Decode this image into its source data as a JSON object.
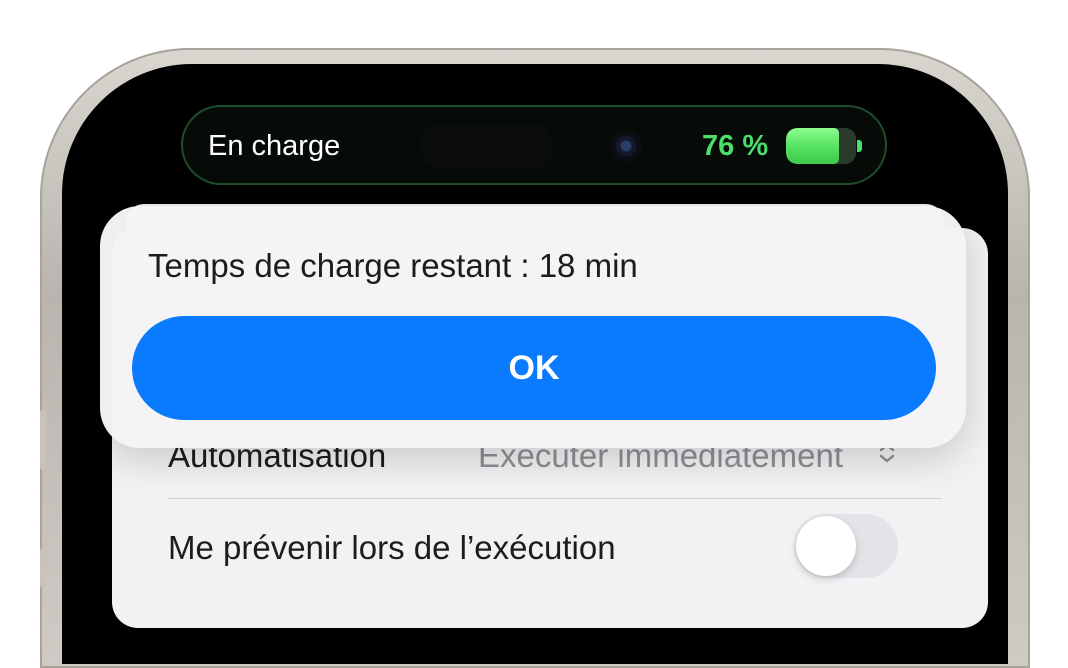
{
  "status_bar": {
    "charging_label": "En charge",
    "battery_percent": "76 %",
    "battery_level": 0.76,
    "accent_color": "#4cdd6b"
  },
  "alert": {
    "message": "Temps de charge restant : 18 min",
    "ok_label": "OK",
    "button_color": "#0a7aff"
  },
  "settings": {
    "automation_label": "Automatisation",
    "automation_value": "Exécuter immédiatement",
    "notify_label": "Me prévenir lors de l’exécution",
    "notify_toggle_on": false
  },
  "icons": {
    "camera": "camera-icon",
    "battery": "battery-icon",
    "chevron": "chevron-up-down-icon"
  }
}
